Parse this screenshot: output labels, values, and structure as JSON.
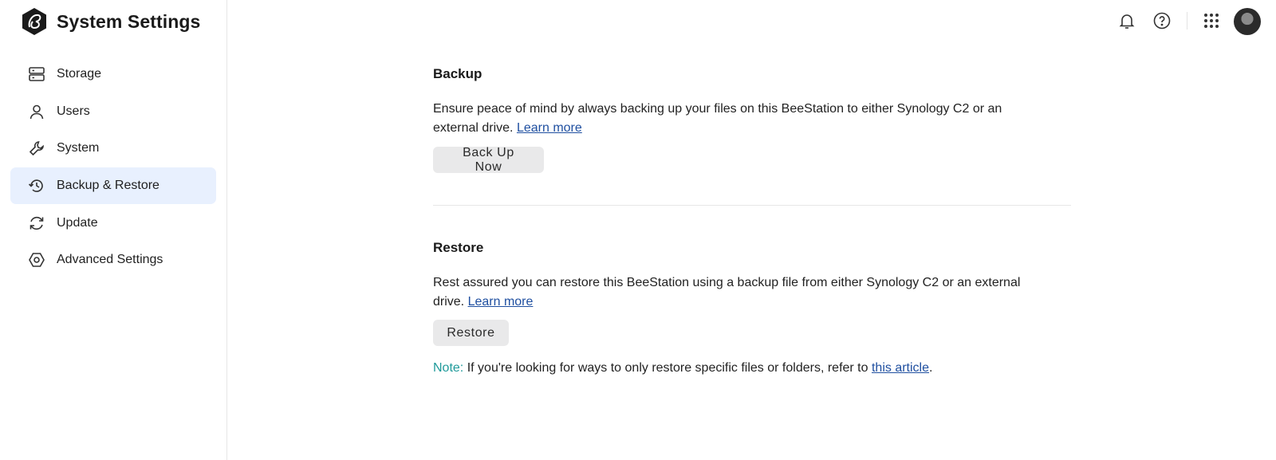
{
  "app": {
    "title": "System Settings"
  },
  "sidebar": {
    "items": [
      {
        "label": "Storage",
        "icon": "storage-icon",
        "active": false
      },
      {
        "label": "Users",
        "icon": "user-icon",
        "active": false
      },
      {
        "label": "System",
        "icon": "wrench-icon",
        "active": false
      },
      {
        "label": "Backup & Restore",
        "icon": "backup-restore-icon",
        "active": true
      },
      {
        "label": "Update",
        "icon": "update-icon",
        "active": false
      },
      {
        "label": "Advanced Settings",
        "icon": "hexagon-settings-icon",
        "active": false
      }
    ]
  },
  "topbar": {
    "icons": [
      "bell-icon",
      "help-icon",
      "apps-grid-icon",
      "avatar"
    ]
  },
  "backup": {
    "title": "Backup",
    "description": "Ensure peace of mind by always backing up your files on this BeeStation to either Synology C2 or an external drive.",
    "learn_more": "Learn more",
    "button_label": "Back Up Now"
  },
  "restore": {
    "title": "Restore",
    "description": "Rest assured you can restore this BeeStation using a backup file from either Synology C2 or an external drive.",
    "learn_more": "Learn more",
    "button_label": "Restore",
    "note_label": "Note:",
    "note_text": "If you're looking for ways to only restore specific files or folders, refer to",
    "note_link": "this article",
    "note_end": "."
  },
  "colors": {
    "active_nav_bg": "#e8f0fe",
    "link": "#1f4fa0",
    "note_label": "#1f9a9a",
    "button_bg": "#e9e9ea"
  }
}
